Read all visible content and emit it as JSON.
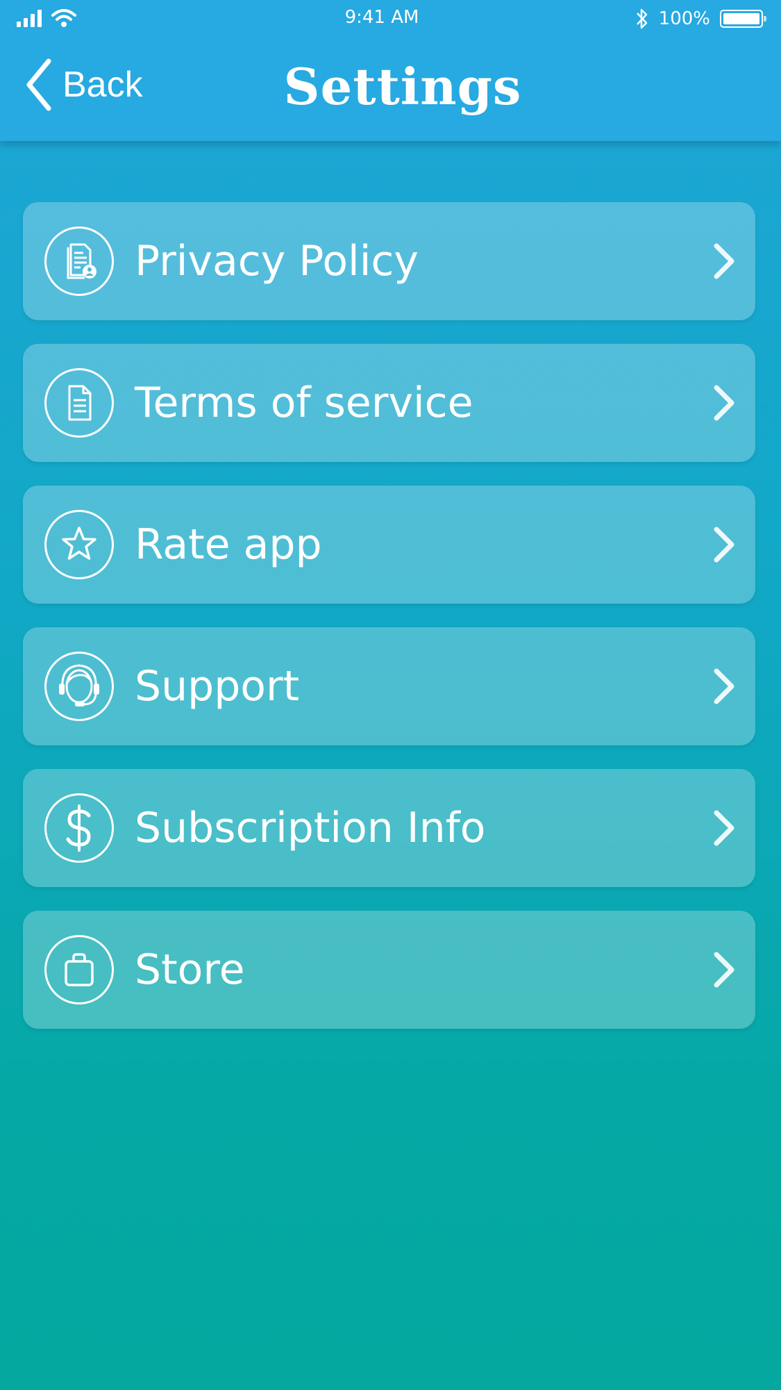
{
  "status_bar": {
    "time": "9:41 AM",
    "battery_text": "100%",
    "battery_level_percent": 100
  },
  "header": {
    "back_label": "Back",
    "title": "Settings"
  },
  "menu": {
    "items": [
      {
        "label": "Privacy Policy",
        "icon": "privacy-document-icon"
      },
      {
        "label": "Terms of service",
        "icon": "document-icon"
      },
      {
        "label": "Rate app",
        "icon": "star-icon"
      },
      {
        "label": "Support",
        "icon": "support-headset-icon"
      },
      {
        "label": "Subscription Info",
        "icon": "dollar-icon"
      },
      {
        "label": "Store",
        "icon": "shopping-bag-icon"
      }
    ]
  },
  "colors": {
    "header_background": "#27a9e1",
    "gradient_top": "#1fa6d8",
    "gradient_bottom": "#04a89e",
    "text": "#ffffff"
  }
}
